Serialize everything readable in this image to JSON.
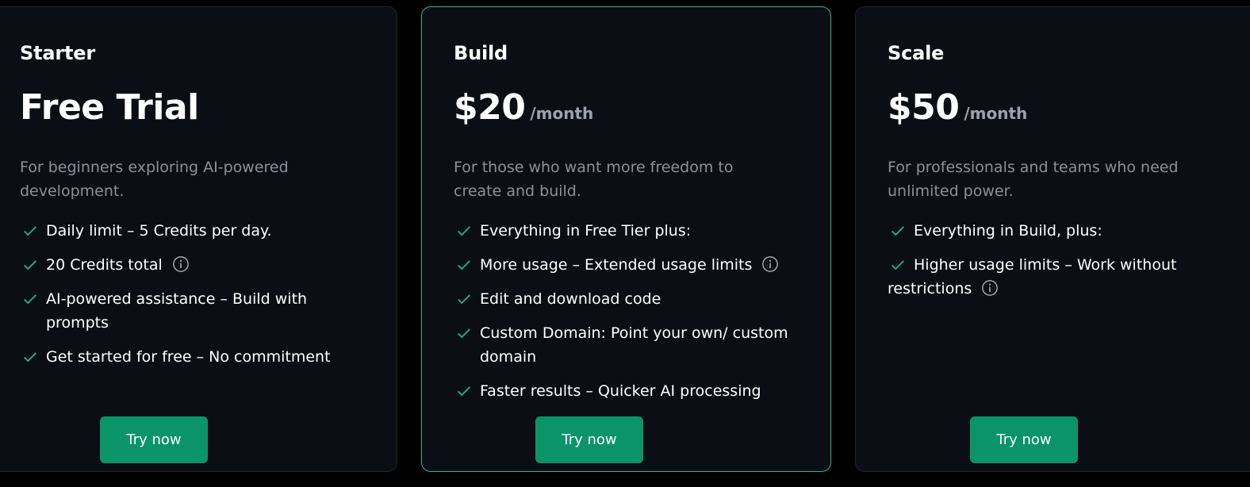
{
  "colors": {
    "background": "#000000",
    "card": "#0b0e14",
    "card_border": "#1f242d",
    "highlight_border": "#2bb98a",
    "accent": "#0b9468",
    "check": "#22b07d",
    "muted_text": "#8b919c"
  },
  "plans": [
    {
      "tier": "Starter",
      "price": "Free Trial",
      "price_unit": "",
      "description": "For beginners exploring AI-powered development.",
      "features": [
        {
          "text": "Daily limit – 5 Credits per day.",
          "info": false
        },
        {
          "text": "20 Credits total",
          "info": true
        },
        {
          "text": "AI-powered assistance – Build with prompts",
          "info": false
        },
        {
          "text": "Get started for free – No commitment",
          "info": false
        }
      ],
      "cta": "Try now"
    },
    {
      "tier": "Build",
      "price": "$20",
      "price_unit": "/month",
      "description": "For those who want more freedom to create and build.",
      "features": [
        {
          "text": "Everything in Free Tier plus:",
          "info": false
        },
        {
          "text": "More usage – Extended usage limits",
          "info": true
        },
        {
          "text": "Edit and download code",
          "info": false
        },
        {
          "text": "Custom Domain: Point your own/ custom domain",
          "info": false
        },
        {
          "text": "Faster results – Quicker AI processing",
          "info": false
        }
      ],
      "cta": "Try now"
    },
    {
      "tier": "Scale",
      "price": "$50",
      "price_unit": "/month",
      "description": "For professionals and teams who need unlimited power.",
      "features": [
        {
          "text": "Everything in Build, plus:",
          "info": false
        },
        {
          "text": "Higher usage limits – Work without restrictions",
          "info": true
        }
      ],
      "cta": "Try now"
    }
  ],
  "icons": {
    "check": "check-icon",
    "info": "info-icon"
  }
}
